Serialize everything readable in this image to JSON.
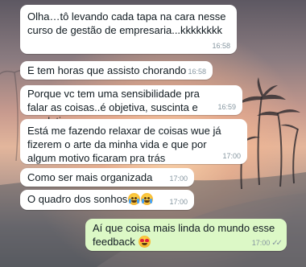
{
  "messages": [
    {
      "text": "Olha…tô levando cada tapa na cara nesse curso de gestão de empresaria...kkkkkkkk",
      "time": "16:58",
      "direction": "in"
    },
    {
      "text": "E tem horas que assisto chorando",
      "time": "16:58",
      "direction": "in"
    },
    {
      "text": "Porque vc tem uma sensibilidade pra falar as coisas..é objetiva,  suscinta e resolutiva",
      "time": "16:59",
      "direction": "in"
    },
    {
      "text": "Está me fazendo relaxar de coisas wue já fizerem o arte da minha vida e que por algum motivo ficaram pra trás",
      "time": "17:00",
      "direction": "in"
    },
    {
      "text": "Como ser mais organizada",
      "time": "17:00",
      "direction": "in"
    },
    {
      "text": "O quadro dos sonhos",
      "time": "17:00",
      "direction": "in",
      "emojis": [
        "loudly-crying-face",
        "loudly-crying-face"
      ]
    },
    {
      "text": "Aí que coisa mais linda do mundo esse feedback",
      "time": "17:00",
      "direction": "out",
      "emojis": [
        "smiling-face-with-heart-eyes"
      ],
      "status": "read"
    }
  ],
  "colors": {
    "incoming_bubble": "#ffffff",
    "outgoing_bubble": "#dcf8c6",
    "timestamp": "#8696a0"
  }
}
